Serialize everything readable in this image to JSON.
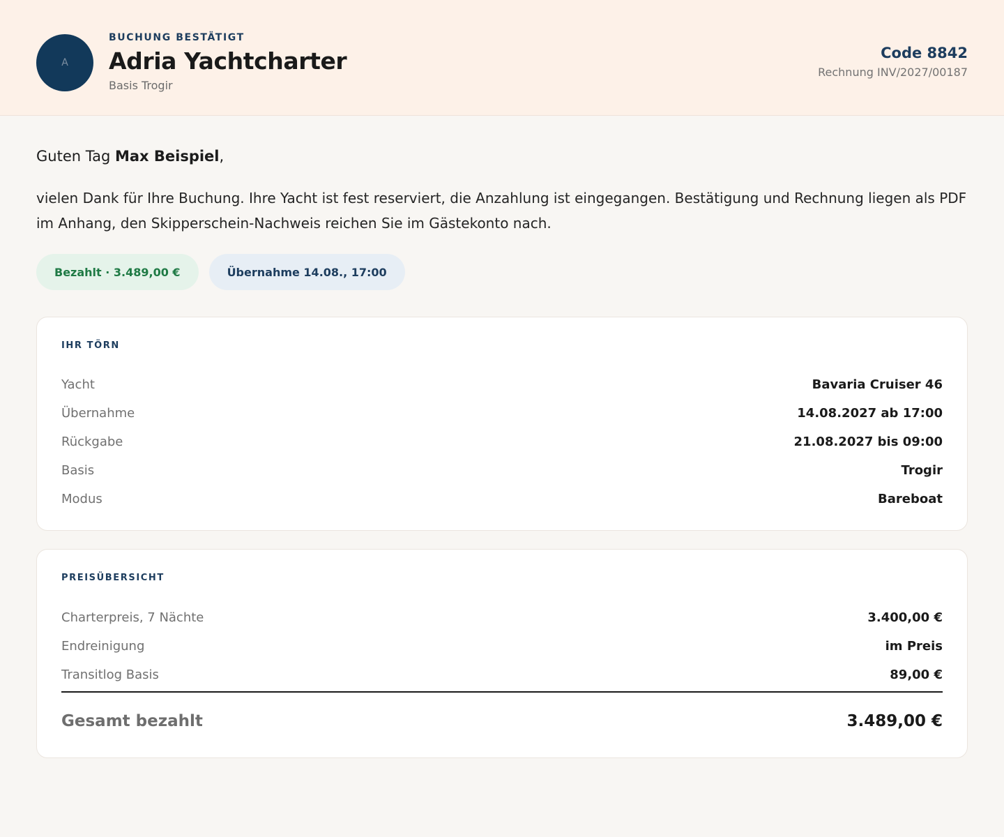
{
  "header": {
    "avatar_letter": "A",
    "eyebrow": "BUCHUNG BESTÄTIGT",
    "company": "Adria Yachtcharter",
    "base": "Basis Trogir",
    "code": "Code 8842",
    "invoice": "Rechnung INV/2027/00187"
  },
  "greeting": {
    "prefix": "Guten Tag ",
    "name": "Max Beispiel",
    "suffix": ","
  },
  "message": "vielen Dank für Ihre Buchung. Ihre Yacht ist fest reserviert, die Anzahlung ist eingegangen. Bestätigung und Rechnung liegen als PDF im Anhang, den Skipperschein-Nachweis reichen Sie im Gästekonto nach.",
  "chips": {
    "paid": "Bezahlt · 3.489,00 €",
    "pickup": "Übernahme 14.08., 17:00"
  },
  "trip": {
    "title": "IHR TÖRN",
    "rows": [
      {
        "label": "Yacht",
        "value": "Bavaria Cruiser 46"
      },
      {
        "label": "Übernahme",
        "value": "14.08.2027 ab 17:00"
      },
      {
        "label": "Rückgabe",
        "value": "21.08.2027 bis 09:00"
      },
      {
        "label": "Basis",
        "value": "Trogir"
      },
      {
        "label": "Modus",
        "value": "Bareboat"
      }
    ]
  },
  "prices": {
    "title": "PREISÜBERSICHT",
    "rows": [
      {
        "label": "Charterpreis, 7 Nächte",
        "value": "3.400,00 €"
      },
      {
        "label": "Endreinigung",
        "value": "im Preis"
      },
      {
        "label": "Transitlog Basis",
        "value": "89,00 €"
      }
    ],
    "total_label": "Gesamt bezahlt",
    "total_value": "3.489,00 €"
  },
  "colors": {
    "navy": "#12395a",
    "header_bg": "#fdf1e8",
    "paid_green": "#1f7a45",
    "paid_bg": "#e5f3ea",
    "pickup_bg": "#e7eef5"
  }
}
